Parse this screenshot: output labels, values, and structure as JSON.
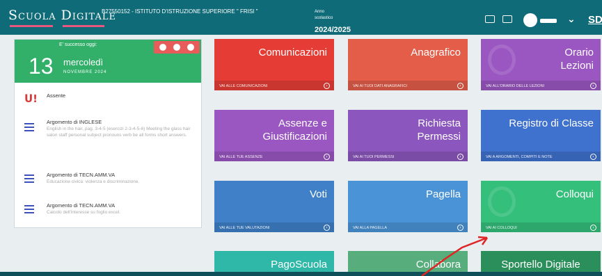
{
  "header": {
    "brand": "Scuola Digitale",
    "school": "B27550152 - ISTITUTO D'ISTRUZIONE SUPERIORE \" FRISI \"",
    "year_label": "Anno scolastico",
    "year_value": "2024/2025",
    "initials": "SD",
    "icons": [
      "id-card-icon",
      "mail-icon",
      "user-avatar",
      "chevron-down-icon"
    ]
  },
  "today": {
    "label": "E' successo oggi:",
    "day_number": "13",
    "weekday": "mercoledì",
    "month": "NOVEMBRE 2024",
    "color": "#32b06a",
    "nav_color": "#e85b5b"
  },
  "events": [
    {
      "icon": "absence-icon",
      "title": "Assente",
      "desc": ""
    },
    {
      "icon": "list-icon",
      "title": "Argomento di INGLESE",
      "desc": "English in the hair, pag. 3-4-5 (esercizi 2-3-4-5-6) Meeting the glass hair salon staff personal subject pronouns verb be all forms short answers."
    },
    {
      "icon": "list-icon",
      "title": "Argomento di TECN.AMM.VA",
      "desc": "Educazione civica: violenza e discriminazione."
    },
    {
      "icon": "list-icon",
      "title": "Argomento di TECN.AMM.VA",
      "desc": "Calcolo dell'interesse su foglio excel."
    }
  ],
  "tiles": [
    {
      "title": "Comunicazioni",
      "link": "VAI ALLE COMUNICAZIONI",
      "color": "#e53d36"
    },
    {
      "title": "Anagrafico",
      "link": "VAI AI TUOI DATI ANAGRAFICI",
      "color": "#e35d49"
    },
    {
      "title": "Orario Lezioni",
      "link": "VAI ALL'ORARIO DELLE LEZIONI",
      "color": "#9a56c1"
    },
    {
      "title": "Assenze e Giustificazioni",
      "link": "VAI ALLE TUE ASSENZE",
      "color": "#9a56c1"
    },
    {
      "title": "Richiesta Permessi",
      "link": "VAI AI TUOI PERMESSI",
      "color": "#8b57be"
    },
    {
      "title": "Registro di Classe",
      "link": "VAI A ARGOMENTI, COMPITI E NOTE",
      "color": "#3f71cf"
    },
    {
      "title": "Voti",
      "link": "VAI ALLE TUE VALUTAZIONI",
      "color": "#3f80c8"
    },
    {
      "title": "Pagella",
      "link": "VAI ALLA PAGELLA",
      "color": "#4a93d6"
    },
    {
      "title": "Colloqui",
      "link": "VAI AI COLLOQUI",
      "color": "#34bf7b"
    },
    {
      "title": "PagoScuola",
      "link": "",
      "color": "#2fb7a8"
    },
    {
      "title": "Collabora",
      "link": "",
      "color": "#58ad7c"
    },
    {
      "title": "Sportello Digitale",
      "link": "",
      "color": "#2b8f5b"
    }
  ],
  "annotation_color": "#e02424"
}
